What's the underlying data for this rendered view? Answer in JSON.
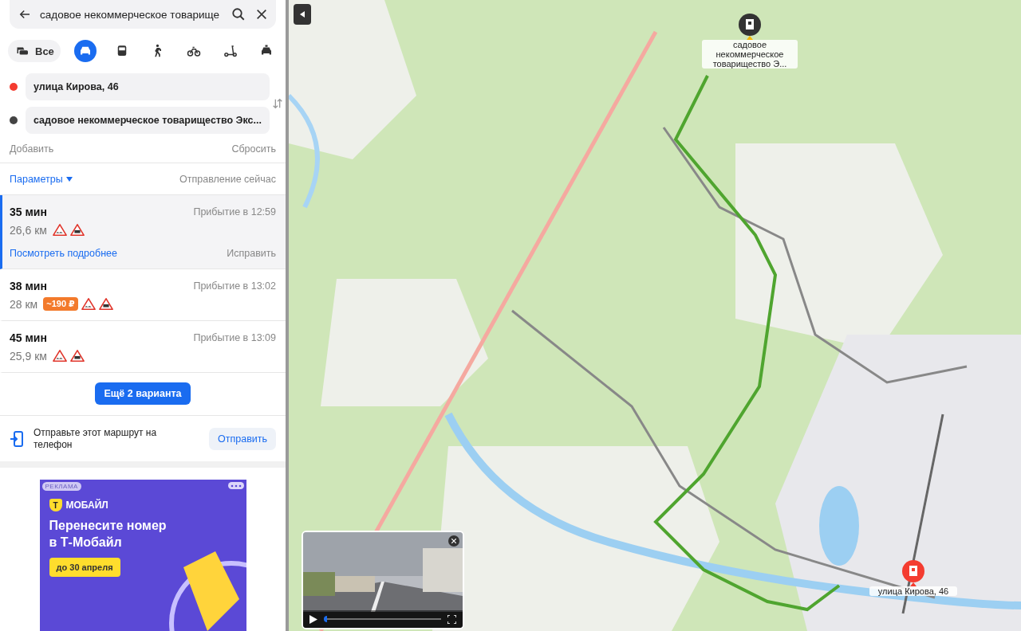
{
  "search": {
    "value": "садовое некоммерческое товарище"
  },
  "modes": [
    {
      "kind": "all",
      "label": "Все",
      "selected": false
    },
    {
      "kind": "car",
      "selected": true
    },
    {
      "kind": "bus",
      "selected": false
    },
    {
      "kind": "walk",
      "selected": false
    },
    {
      "kind": "bike",
      "selected": false
    },
    {
      "kind": "scooter",
      "selected": false
    },
    {
      "kind": "taxi",
      "selected": false
    }
  ],
  "points": [
    {
      "value": "улица Кирова, 46",
      "color": "#f43c30"
    },
    {
      "value": "садовое некоммерческое товарищество Экс...",
      "color": "#444444"
    }
  ],
  "add": "Добавить",
  "reset": "Сбросить",
  "params": "Параметры",
  "departure": "Отправление сейчас",
  "routes": [
    {
      "time": "35 мин",
      "arrival": "Прибытие в 12:59",
      "distance": "26,6 км",
      "signs": [
        {
          "kind": "rough"
        },
        {
          "kind": "works"
        }
      ],
      "selected": true,
      "details": "Посмотреть подробнее",
      "fix": "Исправить"
    },
    {
      "time": "38 мин",
      "arrival": "Прибытие в 13:02",
      "distance": "28 км",
      "toll": "~190 ₽",
      "signs": [
        {
          "kind": "rough"
        },
        {
          "kind": "works"
        }
      ],
      "selected": false
    },
    {
      "time": "45 мин",
      "arrival": "Прибытие в 13:09",
      "distance": "25,9 км",
      "signs": [
        {
          "kind": "rough"
        },
        {
          "kind": "works"
        }
      ],
      "selected": false
    }
  ],
  "more_button": "Ещё 2 варианта",
  "send": {
    "text": "Отправьте этот маршрут на телефон",
    "button": "Отправить"
  },
  "ad": {
    "label": "РЕКЛАМА",
    "brand": "МОБАЙЛ",
    "logo": "Т",
    "headline": "Перенесите номер в Т-Мобайл",
    "badge": "до 30 апреля"
  },
  "map": {
    "pins": [
      {
        "kind": "destination",
        "label": "садовое некоммерческое товарищество Э..."
      },
      {
        "kind": "origin",
        "label": "улица Кирова, 46"
      }
    ],
    "street_view": {
      "level": 0.03
    }
  }
}
